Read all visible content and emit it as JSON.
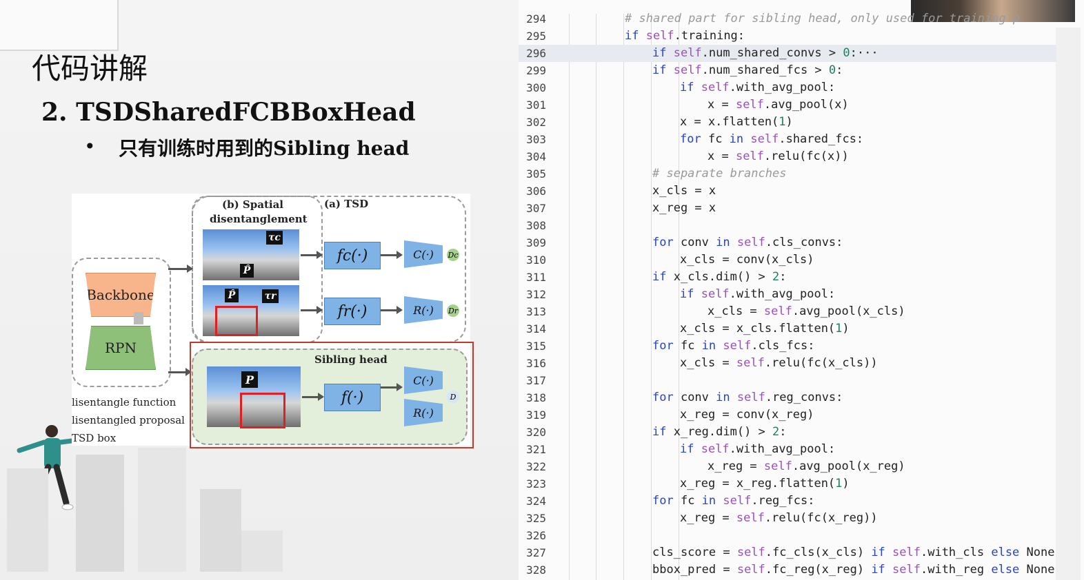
{
  "slide": {
    "title": "代码讲解",
    "subtitle": "2. TSDSharedFCBBoxHead",
    "bullet_symbol": "•",
    "bullet": "只有训练时用到的Sibling head"
  },
  "figure": {
    "spatial_label_line1": "(b) Spatial",
    "spatial_label_line2": "disentanglement",
    "tsd_label": "(a) TSD",
    "backbone": "Backbone",
    "rpn": "RPN",
    "fc": "fc(·)",
    "fr": "fr(·)",
    "cc": "C(·)",
    "rr": "R(·)",
    "dc": "Dc",
    "dr": "Dr",
    "tau_c": "τc",
    "tau_r": "τr",
    "p_tag": "P̂",
    "sibling_head": "Sibling head",
    "f": "f(·)",
    "c2": "C(·)",
    "r2": "R(·)",
    "d": "D",
    "P": "P",
    "legend1": "lisentangle function",
    "legend2": "lisentangled proposal",
    "legend3": "TSD box"
  },
  "editor": {
    "fold_icon": "›",
    "lines": [
      {
        "n": "294",
        "indent": 3,
        "parts": [
          [
            "cmt",
            "# shared part for sibling head, only used for training p"
          ]
        ]
      },
      {
        "n": "295",
        "indent": 3,
        "parts": [
          [
            "kw",
            "if "
          ],
          [
            "slf",
            "self"
          ],
          [
            "",
            ".training:"
          ]
        ]
      },
      {
        "n": "296",
        "indent": 4,
        "hl": true,
        "parts": [
          [
            "kw",
            "if "
          ],
          [
            "slf",
            "self"
          ],
          [
            "",
            ".num_shared_convs > "
          ],
          [
            "num",
            "0"
          ],
          [
            "",
            ":···"
          ]
        ]
      },
      {
        "n": "299",
        "indent": 4,
        "parts": [
          [
            "kw",
            "if "
          ],
          [
            "slf",
            "self"
          ],
          [
            "",
            ".num_shared_fcs > "
          ],
          [
            "num",
            "0"
          ],
          [
            "",
            ":"
          ]
        ]
      },
      {
        "n": "300",
        "indent": 5,
        "parts": [
          [
            "kw",
            "if "
          ],
          [
            "slf",
            "self"
          ],
          [
            "",
            ".with_avg_pool:"
          ]
        ]
      },
      {
        "n": "301",
        "indent": 6,
        "parts": [
          [
            "",
            "x = "
          ],
          [
            "slf",
            "self"
          ],
          [
            "",
            ".avg_pool(x)"
          ]
        ]
      },
      {
        "n": "302",
        "indent": 5,
        "parts": [
          [
            "",
            "x = x.flatten("
          ],
          [
            "num",
            "1"
          ],
          [
            "",
            ")"
          ]
        ]
      },
      {
        "n": "303",
        "indent": 5,
        "parts": [
          [
            "kw",
            "for "
          ],
          [
            "",
            "fc "
          ],
          [
            "kw",
            "in "
          ],
          [
            "slf",
            "self"
          ],
          [
            "",
            ".shared_fcs:"
          ]
        ]
      },
      {
        "n": "304",
        "indent": 6,
        "parts": [
          [
            "",
            "x = "
          ],
          [
            "slf",
            "self"
          ],
          [
            "",
            ".relu(fc(x))"
          ]
        ]
      },
      {
        "n": "305",
        "indent": 4,
        "parts": [
          [
            "cmt",
            "# separate branches"
          ]
        ]
      },
      {
        "n": "306",
        "indent": 4,
        "parts": [
          [
            "",
            "x_cls = x"
          ]
        ]
      },
      {
        "n": "307",
        "indent": 4,
        "parts": [
          [
            "",
            "x_reg = x"
          ]
        ]
      },
      {
        "n": "308",
        "indent": 4,
        "parts": [
          [
            "",
            ""
          ]
        ]
      },
      {
        "n": "309",
        "indent": 4,
        "parts": [
          [
            "kw",
            "for "
          ],
          [
            "",
            "conv "
          ],
          [
            "kw",
            "in "
          ],
          [
            "slf",
            "self"
          ],
          [
            "",
            ".cls_convs:"
          ]
        ]
      },
      {
        "n": "310",
        "indent": 5,
        "parts": [
          [
            "",
            "x_cls = conv(x_cls)"
          ]
        ]
      },
      {
        "n": "311",
        "indent": 4,
        "parts": [
          [
            "kw",
            "if "
          ],
          [
            "",
            "x_cls.dim() > "
          ],
          [
            "num",
            "2"
          ],
          [
            "",
            ":"
          ]
        ]
      },
      {
        "n": "312",
        "indent": 5,
        "parts": [
          [
            "kw",
            "if "
          ],
          [
            "slf",
            "self"
          ],
          [
            "",
            ".with_avg_pool:"
          ]
        ]
      },
      {
        "n": "313",
        "indent": 6,
        "parts": [
          [
            "",
            "x_cls = "
          ],
          [
            "slf",
            "self"
          ],
          [
            "",
            ".avg_pool(x_cls)"
          ]
        ]
      },
      {
        "n": "314",
        "indent": 5,
        "parts": [
          [
            "",
            "x_cls = x_cls.flatten("
          ],
          [
            "num",
            "1"
          ],
          [
            "",
            ")"
          ]
        ]
      },
      {
        "n": "315",
        "indent": 4,
        "parts": [
          [
            "kw",
            "for "
          ],
          [
            "",
            "fc "
          ],
          [
            "kw",
            "in "
          ],
          [
            "slf",
            "self"
          ],
          [
            "",
            ".cls_fcs:"
          ]
        ]
      },
      {
        "n": "316",
        "indent": 5,
        "parts": [
          [
            "",
            "x_cls = "
          ],
          [
            "slf",
            "self"
          ],
          [
            "",
            ".relu(fc(x_cls))"
          ]
        ]
      },
      {
        "n": "317",
        "indent": 4,
        "parts": [
          [
            "",
            ""
          ]
        ]
      },
      {
        "n": "318",
        "indent": 4,
        "parts": [
          [
            "kw",
            "for "
          ],
          [
            "",
            "conv "
          ],
          [
            "kw",
            "in "
          ],
          [
            "slf",
            "self"
          ],
          [
            "",
            ".reg_convs:"
          ]
        ]
      },
      {
        "n": "319",
        "indent": 5,
        "parts": [
          [
            "",
            "x_reg = conv(x_reg)"
          ]
        ]
      },
      {
        "n": "320",
        "indent": 4,
        "parts": [
          [
            "kw",
            "if "
          ],
          [
            "",
            "x_reg.dim() > "
          ],
          [
            "num",
            "2"
          ],
          [
            "",
            ":"
          ]
        ]
      },
      {
        "n": "321",
        "indent": 5,
        "parts": [
          [
            "kw",
            "if "
          ],
          [
            "slf",
            "self"
          ],
          [
            "",
            ".with_avg_pool:"
          ]
        ]
      },
      {
        "n": "322",
        "indent": 6,
        "parts": [
          [
            "",
            "x_reg = "
          ],
          [
            "slf",
            "self"
          ],
          [
            "",
            ".avg_pool(x_reg)"
          ]
        ]
      },
      {
        "n": "323",
        "indent": 5,
        "parts": [
          [
            "",
            "x_reg = x_reg.flatten("
          ],
          [
            "num",
            "1"
          ],
          [
            "",
            ")"
          ]
        ]
      },
      {
        "n": "324",
        "indent": 4,
        "parts": [
          [
            "kw",
            "for "
          ],
          [
            "",
            "fc "
          ],
          [
            "kw",
            "in "
          ],
          [
            "slf",
            "self"
          ],
          [
            "",
            ".reg_fcs:"
          ]
        ]
      },
      {
        "n": "325",
        "indent": 5,
        "parts": [
          [
            "",
            "x_reg = "
          ],
          [
            "slf",
            "self"
          ],
          [
            "",
            ".relu(fc(x_reg))"
          ]
        ]
      },
      {
        "n": "326",
        "indent": 4,
        "parts": [
          [
            "",
            ""
          ]
        ]
      },
      {
        "n": "327",
        "indent": 4,
        "parts": [
          [
            "",
            "cls_score = "
          ],
          [
            "slf",
            "self"
          ],
          [
            "",
            ".fc_cls(x_cls) "
          ],
          [
            "kw",
            "if "
          ],
          [
            "slf",
            "self"
          ],
          [
            "",
            ".with_cls "
          ],
          [
            "kw",
            "else "
          ],
          [
            "",
            "None"
          ]
        ]
      },
      {
        "n": "328",
        "indent": 4,
        "parts": [
          [
            "",
            "bbox_pred = "
          ],
          [
            "slf",
            "self"
          ],
          [
            "",
            ".fc_reg(x_reg) "
          ],
          [
            "kw",
            "if "
          ],
          [
            "slf",
            "self"
          ],
          [
            "",
            ".with_reg "
          ],
          [
            "kw",
            "else "
          ],
          [
            "",
            "None"
          ]
        ]
      }
    ]
  }
}
